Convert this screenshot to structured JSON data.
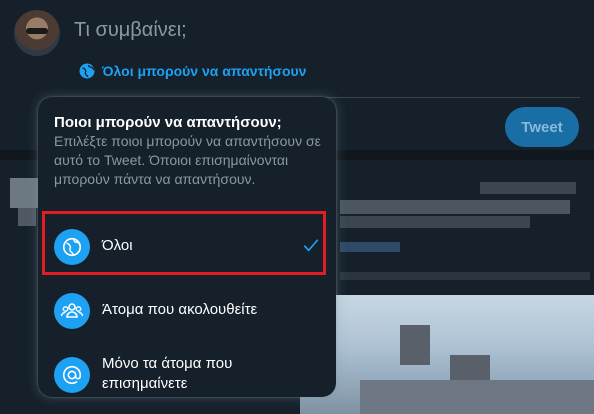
{
  "composer": {
    "placeholder": "Τι συμβαίνει;",
    "reply_setting_label": "Όλοι μπορούν να απαντήσουν",
    "tweet_button_label": "Tweet"
  },
  "popup": {
    "title": "Ποιοι μπορούν να απαντήσουν;",
    "description": "Επιλέξτε ποιοι μπορούν να απαντήσουν σε αυτό το Tweet. Όποιοι επισημαίνονται μπορούν πάντα να απαντήσουν.",
    "options": [
      {
        "label": "Όλοι",
        "icon": "globe-icon",
        "selected": true
      },
      {
        "label": "Άτομα που ακολουθείτε",
        "icon": "people-icon",
        "selected": false
      },
      {
        "label": "Μόνο τα άτομα που επισημαίνετε",
        "icon": "at-icon",
        "selected": false
      }
    ]
  },
  "colors": {
    "background": "#15202b",
    "accent": "#1da1f2",
    "muted_text": "#8899a6",
    "highlight": "#e31b23"
  }
}
